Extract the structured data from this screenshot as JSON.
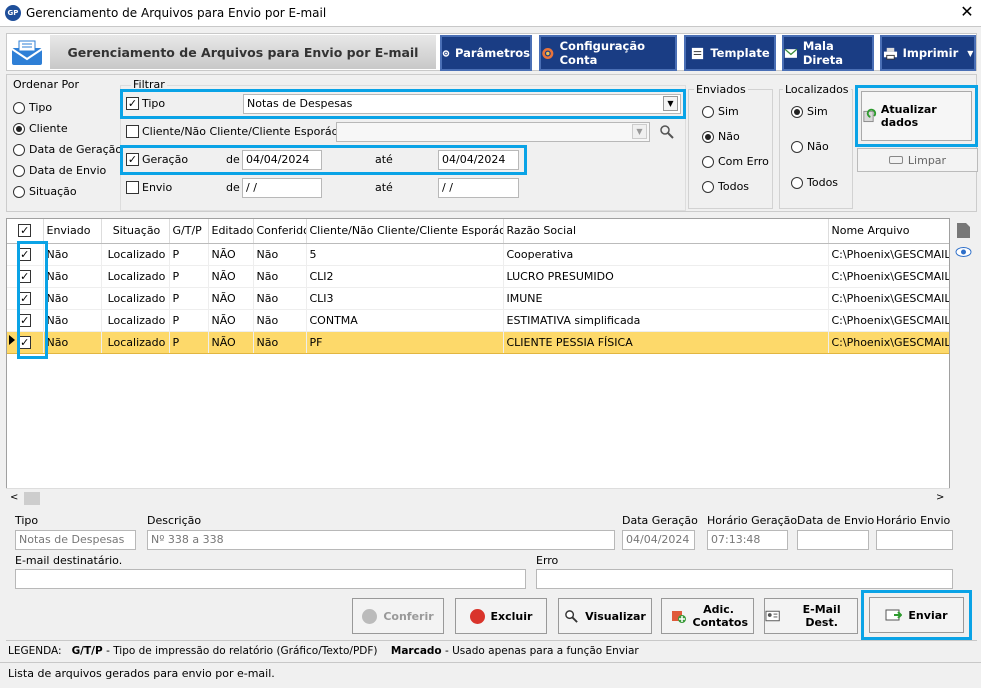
{
  "window": {
    "title": "Gerenciamento de Arquivos para Envio por E-mail",
    "app_icon": "GP"
  },
  "header": {
    "title": "Gerenciamento de Arquivos para Envio por E-mail"
  },
  "toolbar": {
    "parametros": "Parâmetros",
    "configuracao": "Configuração Conta",
    "template": "Template",
    "mala_direta": "Mala Direta",
    "imprimir": "Imprimir"
  },
  "ordenar": {
    "label": "Ordenar Por",
    "options": [
      "Tipo",
      "Cliente",
      "Data de Geração",
      "Data de Envio",
      "Situação"
    ],
    "selected": "Cliente"
  },
  "filtrar": {
    "label": "Filtrar",
    "tipo_label": "Tipo",
    "tipo_value": "Notas de Despesas",
    "cliente_label": "Cliente/Não Cliente/Cliente Esporádico",
    "cliente_value": "",
    "geracao_label": "Geração",
    "envio_label": "Envio",
    "de": "de",
    "ate": "até",
    "geracao_de": "04/04/2024",
    "geracao_ate": "04/04/2024",
    "envio_de": " / /",
    "envio_ate": " / /"
  },
  "enviados": {
    "label": "Enviados",
    "options": [
      "Sim",
      "Não",
      "Com Erro",
      "Todos"
    ],
    "selected": "Não"
  },
  "localizados": {
    "label": "Localizados",
    "options": [
      "Sim",
      "Não",
      "Todos"
    ],
    "selected": "Sim"
  },
  "actions": {
    "atualizar": "Atualizar dados",
    "limpar": "Limpar"
  },
  "table": {
    "columns": [
      "Enviado",
      "Situação",
      "G/T/P",
      "Editado",
      "Conferido",
      "Cliente/Não Cliente/Cliente Esporádico",
      "Razão Social",
      "Nome Arquivo"
    ],
    "rows": [
      [
        "Não",
        "Localizado",
        "P",
        "NÃO",
        "Não",
        "5",
        "Cooperativa",
        "C:\\Phoenix\\GESCMAIL\\("
      ],
      [
        "Não",
        "Localizado",
        "P",
        "NÃO",
        "Não",
        "CLI2",
        "LUCRO PRESUMIDO",
        "C:\\Phoenix\\GESCMAIL\\("
      ],
      [
        "Não",
        "Localizado",
        "P",
        "NÃO",
        "Não",
        "CLI3",
        "IMUNE",
        "C:\\Phoenix\\GESCMAIL\\("
      ],
      [
        "Não",
        "Localizado",
        "P",
        "NÃO",
        "Não",
        "CONTMA",
        "ESTIMATIVA simplificada",
        "C:\\Phoenix\\GESCMAIL\\("
      ],
      [
        "Não",
        "Localizado",
        "P",
        "NÃO",
        "Não",
        "PF",
        "CLIENTE PESSIA FÍSICA",
        "C:\\Phoenix\\GESCMAIL\\("
      ]
    ]
  },
  "detail": {
    "tipo_label": "Tipo",
    "tipo_value": "Notas de Despesas",
    "descricao_label": "Descrição",
    "descricao_value": "Nº 338 a 338",
    "data_geracao_label": "Data Geração",
    "data_geracao_value": "04/04/2024",
    "horario_geracao_label": "Horário Geração",
    "horario_geracao_value": "07:13:48",
    "data_envio_label": "Data de Envio",
    "horario_envio_label": "Horário Envio",
    "email_label": "E-mail destinatário.",
    "erro_label": "Erro"
  },
  "buttons": {
    "conferir": "Conferir",
    "excluir": "Excluir",
    "visualizar": "Visualizar",
    "adic_contatos": "Adic. Contatos",
    "email_dest": "E-Mail Dest.",
    "enviar": "Enviar"
  },
  "legend": {
    "prefix": "LEGENDA:",
    "gtp": "G/T/P",
    "gtp_desc": "- Tipo de impressão do relatório (Gráfico/Texto/PDF)",
    "marcado": "Marcado",
    "marcado_desc": "- Usado apenas para a função Enviar"
  },
  "status": "Lista de arquivos gerados para envio por e-mail."
}
